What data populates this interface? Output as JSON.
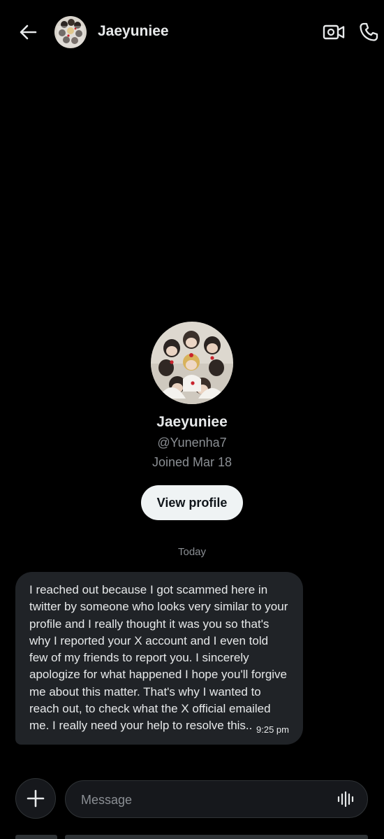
{
  "header": {
    "title": "Jaeyuniee",
    "back_icon": "arrow-left-icon",
    "video_icon": "video-camera-icon",
    "call_icon": "phone-icon"
  },
  "profile": {
    "name": "Jaeyuniee",
    "handle": "@Yunenha7",
    "joined": "Joined Mar 18",
    "view_profile_label": "View profile"
  },
  "conversation": {
    "date_separator": "Today",
    "messages": [
      {
        "text": "I reached out because I got scammed here in twitter by someone who looks very similar to your profile and I really thought it was you so that's why I reported your X account and I even told few of my friends to report you. I sincerely apologize for what happened I hope you'll forgive me about this matter. That's why I wanted to reach out, to check what the X official emailed me. I really need your help to resolve this..",
        "time": "9:25 pm"
      }
    ]
  },
  "composer": {
    "placeholder": "Message",
    "add_icon": "plus-icon",
    "voice_icon": "voice-waveform-icon"
  },
  "colors": {
    "background": "#000000",
    "bubble": "#202327",
    "text_primary": "#e7e9ea",
    "text_secondary": "#8b8f94",
    "button_light": "#eff3f4"
  }
}
